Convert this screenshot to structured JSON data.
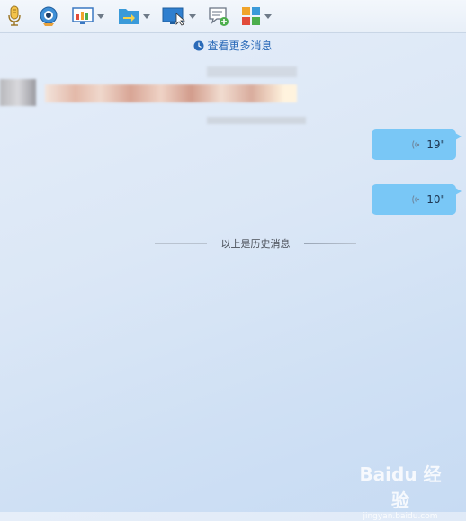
{
  "toolbar": {
    "icons": [
      "microphone-icon",
      "camera-icon",
      "screen-share-icon",
      "file-transfer-icon",
      "remote-assist-icon",
      "add-message-icon",
      "apps-icon"
    ]
  },
  "history": {
    "view_more_label": "查看更多消息",
    "end_label": "以上是历史消息"
  },
  "messages": [
    {
      "direction": "out",
      "type": "voice",
      "duration": "19\""
    },
    {
      "direction": "out",
      "type": "voice",
      "duration": "10\""
    }
  ],
  "watermark": {
    "logo": "Baidu 经验",
    "url": "jingyan.baidu.com"
  },
  "colors": {
    "bubble": "#79c7f6",
    "link": "#2a6ab8"
  }
}
